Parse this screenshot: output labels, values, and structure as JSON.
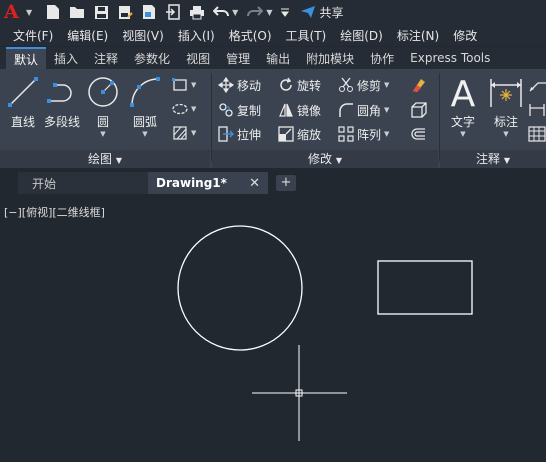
{
  "quick_access": {
    "icons": [
      "new-icon",
      "open-icon",
      "save-icon",
      "save-as-icon",
      "publish-icon",
      "import-icon",
      "print-icon",
      "undo-icon",
      "redo-icon",
      "more-icon"
    ],
    "share_label": "共享"
  },
  "menu": [
    "文件(F)",
    "编辑(E)",
    "视图(V)",
    "插入(I)",
    "格式(O)",
    "工具(T)",
    "绘图(D)",
    "标注(N)",
    "修改"
  ],
  "ribbon_tabs": [
    "默认",
    "插入",
    "注释",
    "参数化",
    "视图",
    "管理",
    "输出",
    "附加模块",
    "协作",
    "Express Tools"
  ],
  "draw_panel": {
    "title": "绘图",
    "tools": [
      "直线",
      "多段线",
      "圆",
      "圆弧"
    ]
  },
  "modify_panel": {
    "title": "修改",
    "tools": [
      "移动",
      "旋转",
      "修剪",
      "复制",
      "镜像",
      "圆角",
      "拉伸",
      "缩放",
      "阵列"
    ]
  },
  "annotation_panel": {
    "title": "注释",
    "tools": [
      "文字",
      "标注"
    ]
  },
  "doc_tabs": {
    "start": "开始",
    "active": "Drawing1*"
  },
  "viewport": {
    "label": "[−][俯视][二维线框]"
  },
  "colors": {
    "background": "#212830",
    "ribbon": "#3b4350",
    "accent": "#3b8fe0",
    "logo": "#e02020",
    "geometry": "#ffffff"
  }
}
